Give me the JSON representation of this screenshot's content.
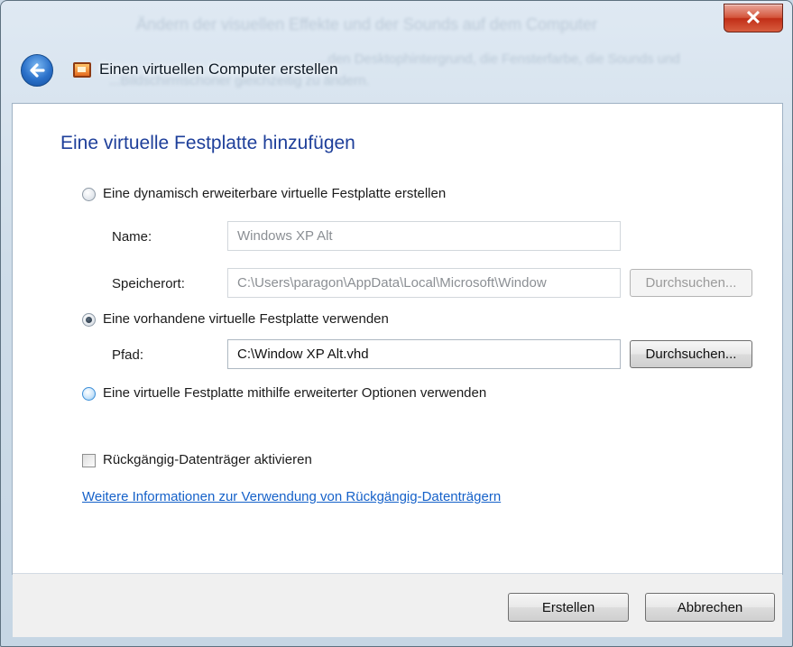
{
  "window": {
    "title": "Einen virtuellen Computer erstellen",
    "close_symbol": "✕",
    "background_blur_text": [
      "Ändern der visuellen Effekte und der Sounds auf dem Computer",
      "...den Desktophintergrund, die Fensterfarbe, die Sounds und",
      "...Bildschirmschoner gleichzeitig zu ändern."
    ]
  },
  "page": {
    "title": "Eine virtuelle Festplatte hinzufügen"
  },
  "option_dynamic": {
    "label": "Eine dynamisch erweiterbare virtuelle Festplatte erstellen",
    "checked": false,
    "name_label": "Name:",
    "name_value": "Windows XP Alt",
    "location_label": "Speicherort:",
    "location_value": "C:\\Users\\paragon\\AppData\\Local\\Microsoft\\Window",
    "browse_label": "Durchsuchen..."
  },
  "option_existing": {
    "label": "Eine vorhandene virtuelle Festplatte verwenden",
    "checked": true,
    "path_label": "Pfad:",
    "path_value": "C:\\Window XP Alt.vhd",
    "browse_label": "Durchsuchen..."
  },
  "option_advanced": {
    "label": "Eine virtuelle Festplatte mithilfe erweiterter Optionen verwenden",
    "checked": false
  },
  "undo_disks": {
    "label": "Rückgängig-Datenträger aktivieren",
    "checked": false
  },
  "more_info_link": "Weitere Informationen zur Verwendung von Rückgängig-Datenträgern",
  "footer": {
    "create_label": "Erstellen",
    "cancel_label": "Abbrechen"
  },
  "icons": {
    "back": "back-arrow-icon",
    "app": "virtual-pc-icon",
    "close": "close-icon"
  }
}
